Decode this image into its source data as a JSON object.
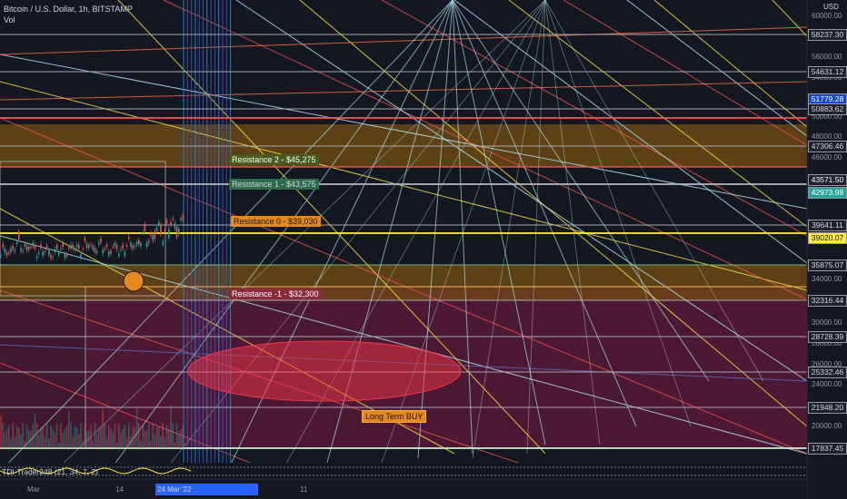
{
  "header": {
    "symbol": "Bitcoin / U.S. Dollar, 1h, BITSTAMP",
    "vol_label": "Vol"
  },
  "price_axis": {
    "currency": "USD",
    "ticks": [
      "60000.00",
      "56000.00",
      "54000.00",
      "50000.00",
      "48000.00",
      "46000.00",
      "34000.00",
      "30000.00",
      "28000.00",
      "26000.00",
      "24000.00",
      "20000.00"
    ],
    "tags": [
      {
        "value": "58237.30",
        "bg": "#1e222d",
        "fg": "#d1d4dc"
      },
      {
        "value": "54631.12",
        "bg": "#1e222d",
        "fg": "#d1d4dc"
      },
      {
        "value": "51779.28",
        "bg": "#1848cc",
        "fg": "#ffffff"
      },
      {
        "value": "50883.62",
        "bg": "#1e222d",
        "fg": "#d1d4dc"
      },
      {
        "value": "47306.46",
        "bg": "#1e222d",
        "fg": "#d1d4dc"
      },
      {
        "value": "43571.50",
        "bg": "#1e222d",
        "fg": "#ffffff"
      },
      {
        "value": "42973.98",
        "bg": "#26a69a",
        "fg": "#ffffff"
      },
      {
        "value": "39641.11",
        "bg": "#1e222d",
        "fg": "#d1d4dc"
      },
      {
        "value": "39020.07",
        "bg": "#ffeb3b",
        "fg": "#131722"
      },
      {
        "value": "35875.07",
        "bg": "#1e222d",
        "fg": "#d1d4dc"
      },
      {
        "value": "32316.44",
        "bg": "#1e222d",
        "fg": "#d1d4dc"
      },
      {
        "value": "28728.39",
        "bg": "#1e222d",
        "fg": "#d1d4dc"
      },
      {
        "value": "25332.46",
        "bg": "#1e222d",
        "fg": "#d1d4dc"
      },
      {
        "value": "21948.20",
        "bg": "#1e222d",
        "fg": "#d1d4dc"
      },
      {
        "value": "17837.45",
        "bg": "#1e222d",
        "fg": "#d1d4dc"
      }
    ]
  },
  "annotations": {
    "resistance_2": "Resistance 2 -  $45,275",
    "resistance_1": "Resistance 1 -  $43,575",
    "resistance_0": "Resistance 0 -  $39,030",
    "resistance_m1": "Resistance -1 -  $32,300",
    "long_term_buy": "Long Term BUY"
  },
  "oscillator": {
    "label": "TDI-Trader248 (21, 34, 7, 2)"
  },
  "time_axis": {
    "ticks": [
      "Mar",
      "14",
      "11"
    ],
    "date_box": "24 Mar '22"
  },
  "colors": {
    "background": "#131722",
    "resistance_band": "#ff9800",
    "support_band": "#e91e63",
    "buy_ellipse": "#f23645",
    "candle_up": "#26a69a",
    "candle_down": "#ef5350"
  }
}
